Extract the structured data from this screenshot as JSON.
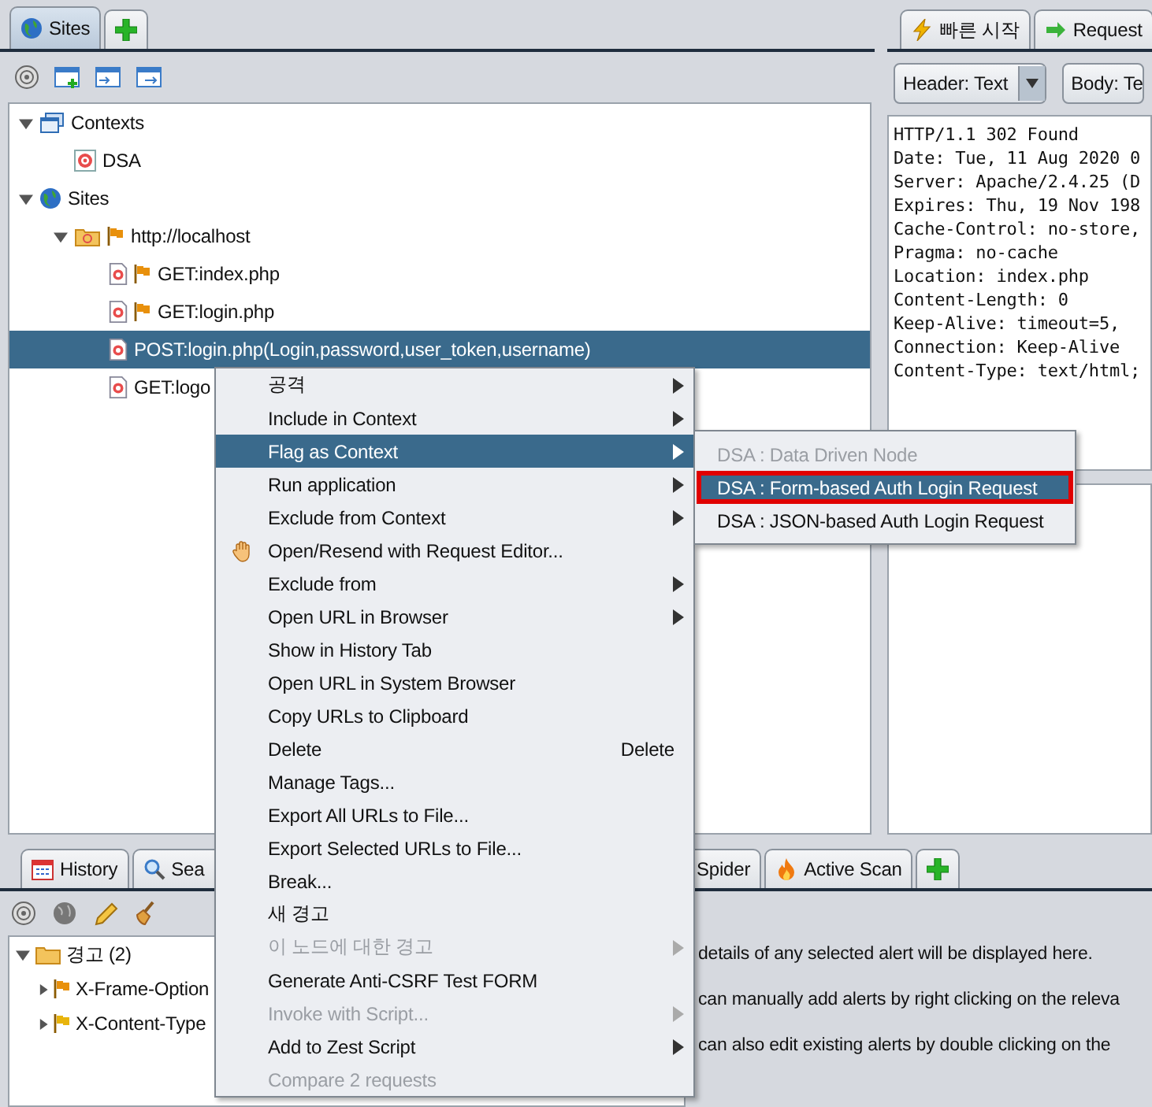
{
  "top_tabs": [
    {
      "label": "Sites",
      "kind": "globe",
      "selected": true
    }
  ],
  "right_tabs": [
    {
      "label": "빠른 시작",
      "kind": "bolt",
      "selected": false
    },
    {
      "label": "Request",
      "kind": "arrow",
      "selected": false
    }
  ],
  "view_selectors": [
    {
      "label": "Header: Text"
    },
    {
      "label": "Body: Te"
    }
  ],
  "sites_tree": [
    {
      "label": "Contexts",
      "kind": "contexts",
      "expanded": true,
      "flagged": false,
      "selected": false,
      "children": [
        {
          "label": "DSA",
          "kind": "context",
          "flagged": false,
          "selected": false
        }
      ]
    },
    {
      "label": "Sites",
      "kind": "sites",
      "expanded": true,
      "flagged": false,
      "selected": false,
      "children": [
        {
          "label": "http://localhost",
          "kind": "host",
          "expanded": true,
          "flagged": true,
          "selected": false,
          "children": [
            {
              "label": "GET:index.php",
              "kind": "page",
              "flagged": true,
              "selected": false
            },
            {
              "label": "GET:login.php",
              "kind": "page",
              "flagged": true,
              "selected": false
            },
            {
              "label": "POST:login.php(Login,password,user_token,username)",
              "kind": "page",
              "flagged": false,
              "selected": true
            },
            {
              "label": "GET:logo",
              "kind": "page",
              "flagged": false,
              "selected": false
            }
          ]
        }
      ]
    }
  ],
  "response_header": [
    "HTTP/1.1 302 Found",
    "Date: Tue, 11 Aug 2020 0",
    "Server: Apache/2.4.25 (D",
    "Expires: Thu, 19 Nov 198",
    "Cache-Control: no-store,",
    "Pragma: no-cache",
    "Location: index.php",
    "Content-Length: 0",
    "Keep-Alive: timeout=5,",
    "Connection: Keep-Alive",
    "Content-Type: text/html;"
  ],
  "bottom_tabs": [
    {
      "label": "History",
      "kind": "calendar",
      "selected": false
    },
    {
      "label": "Sea",
      "kind": "search",
      "selected": false
    },
    {
      "label": "Spider",
      "kind": "text",
      "selected": false
    },
    {
      "label": "Active Scan",
      "kind": "flame",
      "selected": false
    }
  ],
  "alerts_tree": [
    {
      "label": "경고 (2)",
      "kind": "folder",
      "expanded": true,
      "children": [
        {
          "label": "X-Frame-Option",
          "kind": "alert",
          "expanded": false,
          "color": "#e8900c"
        },
        {
          "label": "X-Content-Type",
          "kind": "alert",
          "expanded": false,
          "color": "#e8b40c"
        }
      ]
    }
  ],
  "alert_details": [
    "details of any selected alert will be displayed here.",
    "can manually add alerts by right clicking on the releva",
    "can also edit existing alerts by double clicking on the"
  ],
  "context_menu": [
    {
      "label": "공격",
      "submenu": true,
      "disabled": false,
      "selected": false
    },
    {
      "label": "Include in Context",
      "submenu": true,
      "disabled": false,
      "selected": false
    },
    {
      "label": "Flag as Context",
      "submenu": true,
      "disabled": false,
      "selected": true
    },
    {
      "label": "Run application",
      "submenu": true,
      "disabled": false,
      "selected": false
    },
    {
      "label": "Exclude from Context",
      "submenu": true,
      "disabled": false,
      "selected": false
    },
    {
      "label": "Open/Resend with Request Editor...",
      "submenu": false,
      "disabled": false,
      "selected": false,
      "kind": "icon"
    },
    {
      "label": "Exclude from",
      "submenu": true,
      "disabled": false,
      "selected": false
    },
    {
      "label": "Open URL in Browser",
      "submenu": true,
      "disabled": false,
      "selected": false
    },
    {
      "label": "Show in History Tab",
      "submenu": false,
      "disabled": false,
      "selected": false
    },
    {
      "label": "Open URL in System Browser",
      "submenu": false,
      "disabled": false,
      "selected": false
    },
    {
      "label": "Copy URLs to Clipboard",
      "submenu": false,
      "disabled": false,
      "selected": false
    },
    {
      "label": "Delete",
      "submenu": false,
      "disabled": false,
      "selected": false,
      "shortcut": "Delete"
    },
    {
      "label": "Manage Tags...",
      "submenu": false,
      "disabled": false,
      "selected": false
    },
    {
      "label": "Export All URLs to File...",
      "submenu": false,
      "disabled": false,
      "selected": false
    },
    {
      "label": "Export Selected URLs to File...",
      "submenu": false,
      "disabled": false,
      "selected": false
    },
    {
      "label": "Break...",
      "submenu": false,
      "disabled": false,
      "selected": false
    },
    {
      "label": "새 경고",
      "submenu": false,
      "disabled": false,
      "selected": false
    },
    {
      "label": "이 노드에 대한 경고",
      "submenu": true,
      "disabled": true,
      "selected": false
    },
    {
      "label": "Generate Anti-CSRF Test FORM",
      "submenu": false,
      "disabled": false,
      "selected": false
    },
    {
      "label": "Invoke with Script...",
      "submenu": true,
      "disabled": true,
      "selected": false
    },
    {
      "label": "Add to Zest Script",
      "submenu": true,
      "disabled": false,
      "selected": false
    },
    {
      "label": "Compare 2 requests",
      "submenu": false,
      "disabled": true,
      "selected": false
    }
  ],
  "submenu": [
    {
      "label": "DSA : Data Driven Node",
      "disabled": true,
      "selected": false,
      "outlined": false
    },
    {
      "label": "DSA : Form-based Auth Login Request",
      "disabled": false,
      "selected": true,
      "outlined": true
    },
    {
      "label": "DSA : JSON-based Auth Login Request",
      "disabled": false,
      "selected": false,
      "outlined": false
    }
  ]
}
